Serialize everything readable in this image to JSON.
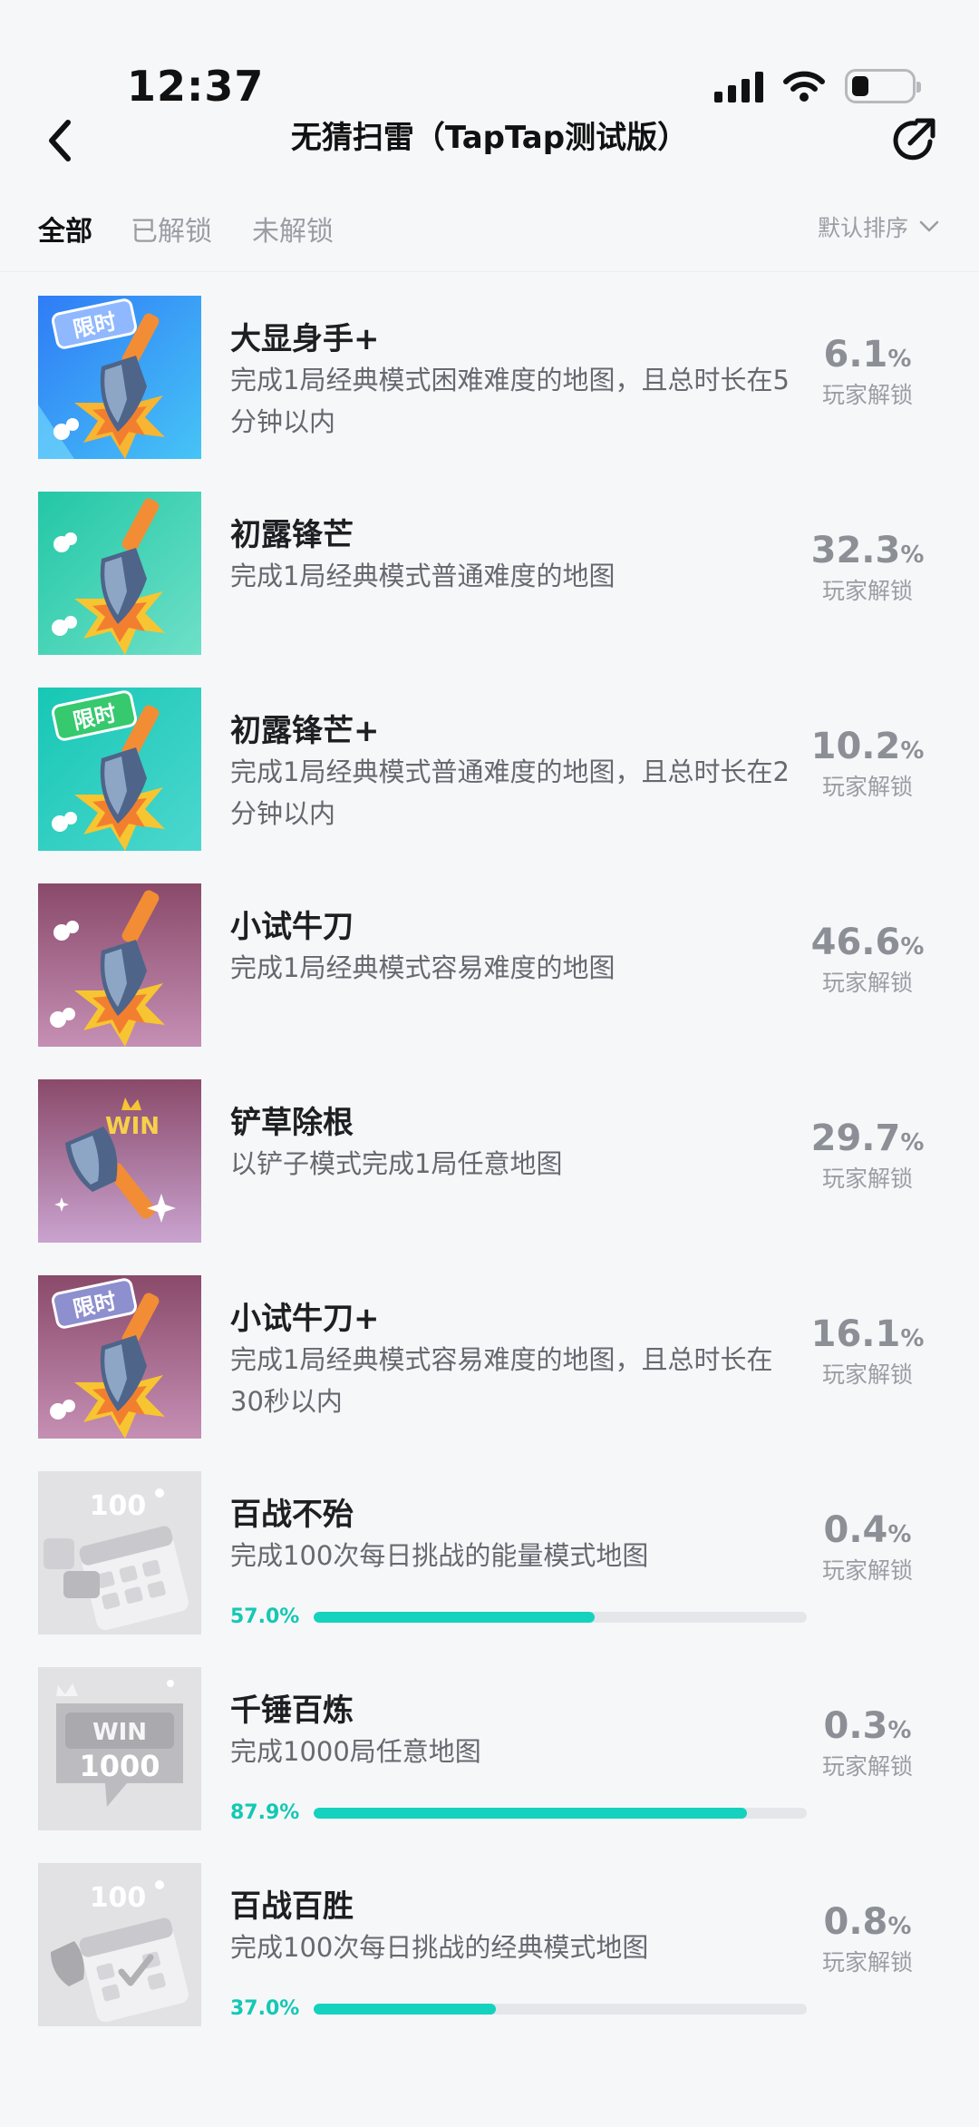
{
  "status_bar": {
    "time": "12:37"
  },
  "nav": {
    "title": "无猜扫雷（TapTap测试版）"
  },
  "filter": {
    "tabs": [
      {
        "label": "全部",
        "active": true
      },
      {
        "label": "已解锁",
        "active": false
      },
      {
        "label": "未解锁",
        "active": false
      }
    ],
    "sort_label": "默认排序"
  },
  "stat_unit": "%",
  "stat_label": "玩家解锁",
  "colors": {
    "accent": "#14d2be",
    "progress_text": "#14c8b4"
  },
  "achievements": [
    {
      "title": "大显身手+",
      "desc": "完成1局经典模式困难难度的地图，且总时长在5分钟以内",
      "rate": "6.1",
      "badge": {
        "theme": "blue",
        "icon": "shovel-icon",
        "tag": "限时"
      }
    },
    {
      "title": "初露锋芒",
      "desc": "完成1局经典模式普通难度的地图",
      "rate": "32.3",
      "badge": {
        "theme": "green",
        "icon": "shovel-icon",
        "tag": ""
      }
    },
    {
      "title": "初露锋芒+",
      "desc": "完成1局经典模式普通难度的地图，且总时长在2分钟以内",
      "rate": "10.2",
      "badge": {
        "theme": "green",
        "icon": "shovel-icon",
        "tag": "限时"
      }
    },
    {
      "title": "小试牛刀",
      "desc": "完成1局经典模式容易难度的地图",
      "rate": "46.6",
      "badge": {
        "theme": "purple",
        "icon": "shovel-icon",
        "tag": ""
      }
    },
    {
      "title": "铲草除根",
      "desc": "以铲子模式完成1局任意地图",
      "rate": "29.7",
      "badge": {
        "theme": "purple",
        "icon": "win-shovel-icon",
        "tag": "WIN"
      }
    },
    {
      "title": "小试牛刀+",
      "desc": "完成1局经典模式容易难度的地图，且总时长在30秒以内",
      "rate": "16.1",
      "badge": {
        "theme": "purple",
        "icon": "shovel-icon",
        "tag": "限时"
      }
    },
    {
      "title": "百战不殆",
      "desc": "完成100次每日挑战的能量模式地图",
      "rate": "0.4",
      "progress": 57.0,
      "progress_text": "57.0%",
      "badge": {
        "theme": "locked",
        "icon": "calendar-icon",
        "tag": "100"
      }
    },
    {
      "title": "千锤百炼",
      "desc": "完成1000局任意地图",
      "rate": "0.3",
      "progress": 87.9,
      "progress_text": "87.9%",
      "badge": {
        "theme": "locked",
        "icon": "win-1000-icon",
        "tag": "WIN 1000"
      }
    },
    {
      "title": "百战百胜",
      "desc": "完成100次每日挑战的经典模式地图",
      "rate": "0.8",
      "progress": 37.0,
      "progress_text": "37.0%",
      "badge": {
        "theme": "locked",
        "icon": "calendar-icon",
        "tag": "100"
      }
    }
  ]
}
